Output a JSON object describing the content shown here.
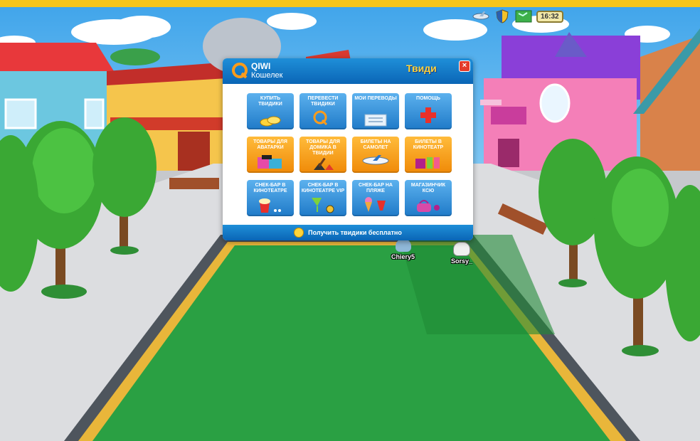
{
  "hud": {
    "clock": "16:32",
    "icons": [
      "plane-icon",
      "shield-icon",
      "map-icon"
    ]
  },
  "players": [
    {
      "name": "Chiery5",
      "color": "#8fb8d8"
    },
    {
      "name": "Sorsy_",
      "color": "#f0f0f0"
    }
  ],
  "dialog": {
    "brand": "QIWI",
    "brand_sub": "Кошелек",
    "game_logo": "Твиди",
    "close_label": "×",
    "tiles": [
      {
        "label": "Купить твидики",
        "style": "blue",
        "icon": "coins-icon"
      },
      {
        "label": "Перевести твидики",
        "style": "blue",
        "icon": "qiwi-transfer-icon"
      },
      {
        "label": "Мои переводы",
        "style": "blue",
        "icon": "document-icon"
      },
      {
        "label": "Помощь",
        "style": "blue",
        "icon": "red-cross-icon"
      },
      {
        "label": "Товары для аватарки",
        "style": "orange",
        "icon": "clothes-icon"
      },
      {
        "label": "Товары для домика в Твидии",
        "style": "orange",
        "icon": "guitar-icon"
      },
      {
        "label": "Билеты на самолет",
        "style": "orange",
        "icon": "airplane-icon"
      },
      {
        "label": "Билеты в кинотеатр",
        "style": "orange",
        "icon": "ticket-icon"
      },
      {
        "label": "Снек-бар в кинотеатре",
        "style": "blue",
        "icon": "popcorn-icon"
      },
      {
        "label": "Снек-бар в кинотеатре VIP",
        "style": "blue",
        "icon": "cocktail-icon"
      },
      {
        "label": "Снек-бар на пляже",
        "style": "blue",
        "icon": "ice-cream-icon"
      },
      {
        "label": "Магазинчик Ксю",
        "style": "blue",
        "icon": "handbag-icon"
      }
    ],
    "footer_text": "Получить твидики бесплатно"
  }
}
